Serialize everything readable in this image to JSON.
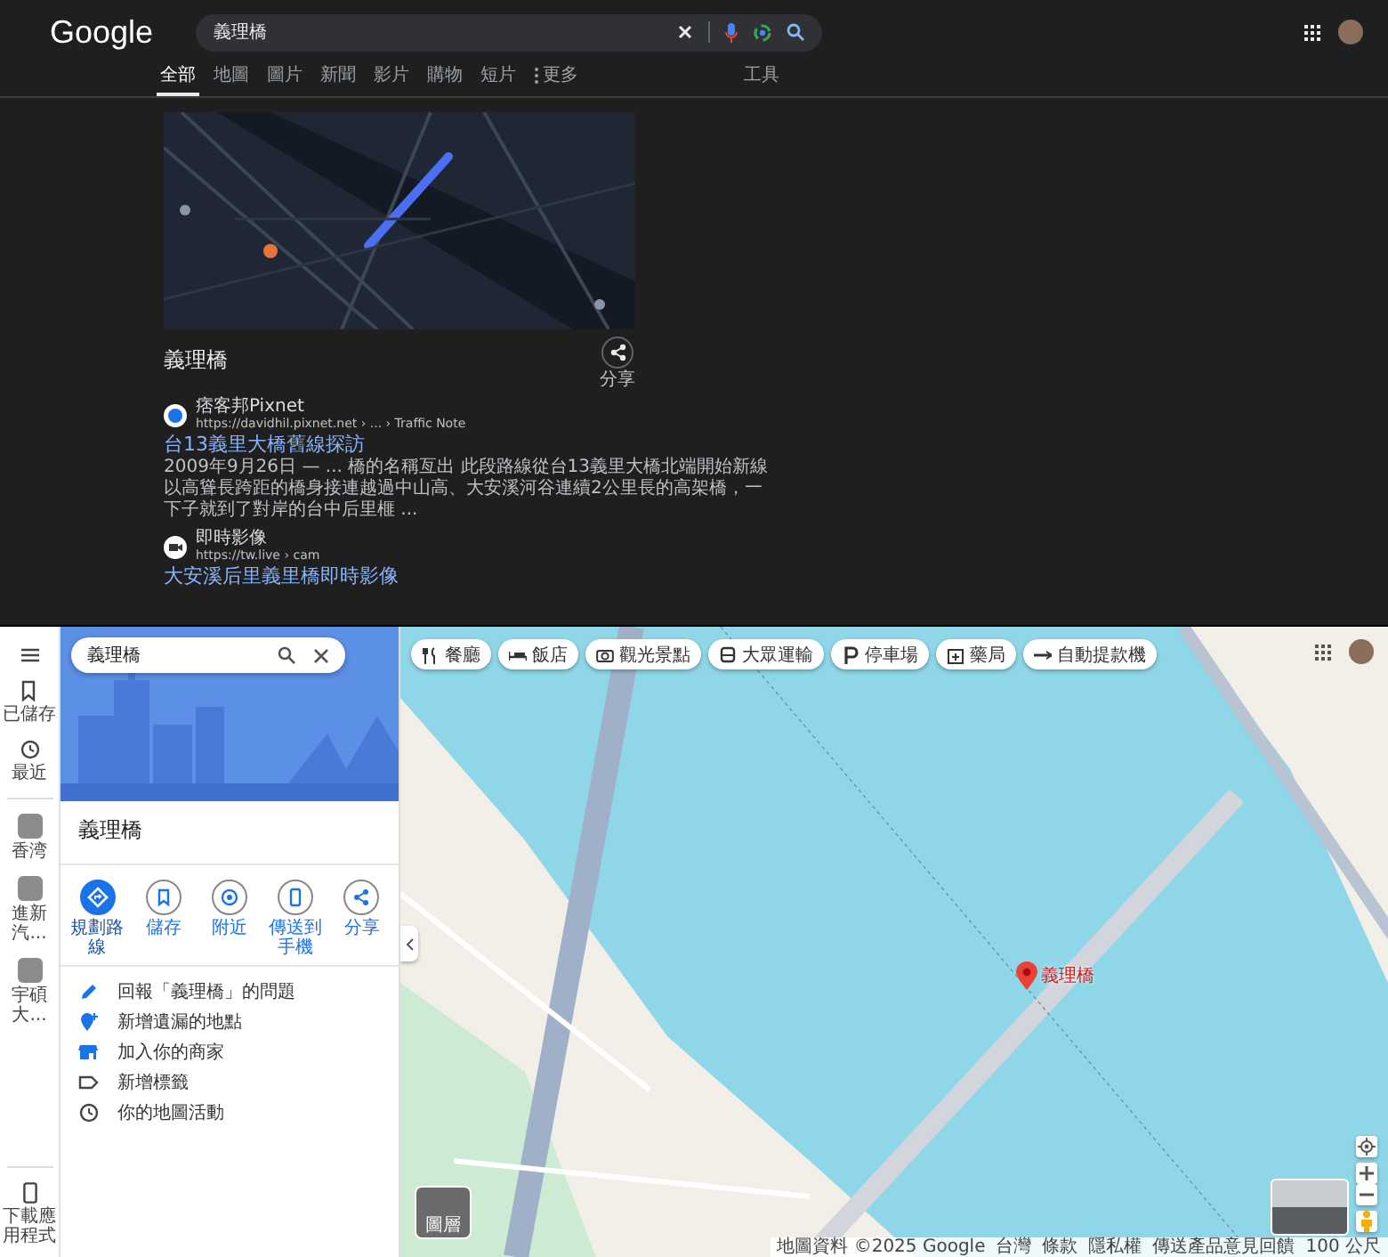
{
  "search_page": {
    "logo": "Google",
    "query": "義理橋",
    "tabs": [
      {
        "label": "全部",
        "selected": true
      },
      {
        "label": "地圖",
        "selected": false
      },
      {
        "label": "圖片",
        "selected": false
      },
      {
        "label": "新聞",
        "selected": false
      },
      {
        "label": "影片",
        "selected": false
      },
      {
        "label": "購物",
        "selected": false
      },
      {
        "label": "短片",
        "selected": false
      },
      {
        "label": "更多",
        "selected": false
      }
    ],
    "tools": "工具",
    "place": {
      "title": "義理橋",
      "share": "分享"
    },
    "results": [
      {
        "source": "痞客邦Pixnet",
        "url": "https://davidhil.pixnet.net › ... › Traffic Note",
        "title": "台13義里大橋舊線探訪",
        "snippet": "2009年9月26日 — ... 橋的名稱亙出 此段路線從台13義里大橋北端開始新線以高聳長跨距的橋身接連越過中山高、大安溪河谷連續2公里長的高架橋，一下子就到了對岸的台中后里榧 ..."
      },
      {
        "source": "即時影像",
        "url": "https://tw.live › cam",
        "title": "大安溪后里義里橋即時影像"
      }
    ]
  },
  "maps": {
    "rail": [
      {
        "kind": "nav",
        "label": "已儲存"
      },
      {
        "kind": "nav",
        "label": "最近"
      },
      {
        "kind": "place",
        "label": "香湾"
      },
      {
        "kind": "place",
        "label": "進新汽..."
      },
      {
        "kind": "place",
        "label": "宇碩大..."
      }
    ],
    "download": "下載應用程式",
    "panel": {
      "query": "義理橋",
      "title": "義理橋",
      "actions": [
        {
          "label": "規劃路線",
          "selected": true
        },
        {
          "label": "儲存",
          "selected": false
        },
        {
          "label": "附近",
          "selected": false
        },
        {
          "label": "傳送到手機",
          "selected": false
        },
        {
          "label": "分享",
          "selected": false
        }
      ],
      "links": [
        "回報「義理橋」的問題",
        "新增遺漏的地點",
        "加入你的商家",
        "新增標籤",
        "你的地圖活動"
      ]
    },
    "chips": [
      "餐廳",
      "飯店",
      "觀光景點",
      "大眾運輸",
      "停車場",
      "藥局",
      "自動提款機"
    ],
    "pin_label": "義理橋",
    "layers": "圖層",
    "footer": [
      "地圖資料 ©2025 Google",
      "台灣",
      "條款",
      "隱私權",
      "傳送產品意見回饋",
      "100 公尺"
    ]
  }
}
